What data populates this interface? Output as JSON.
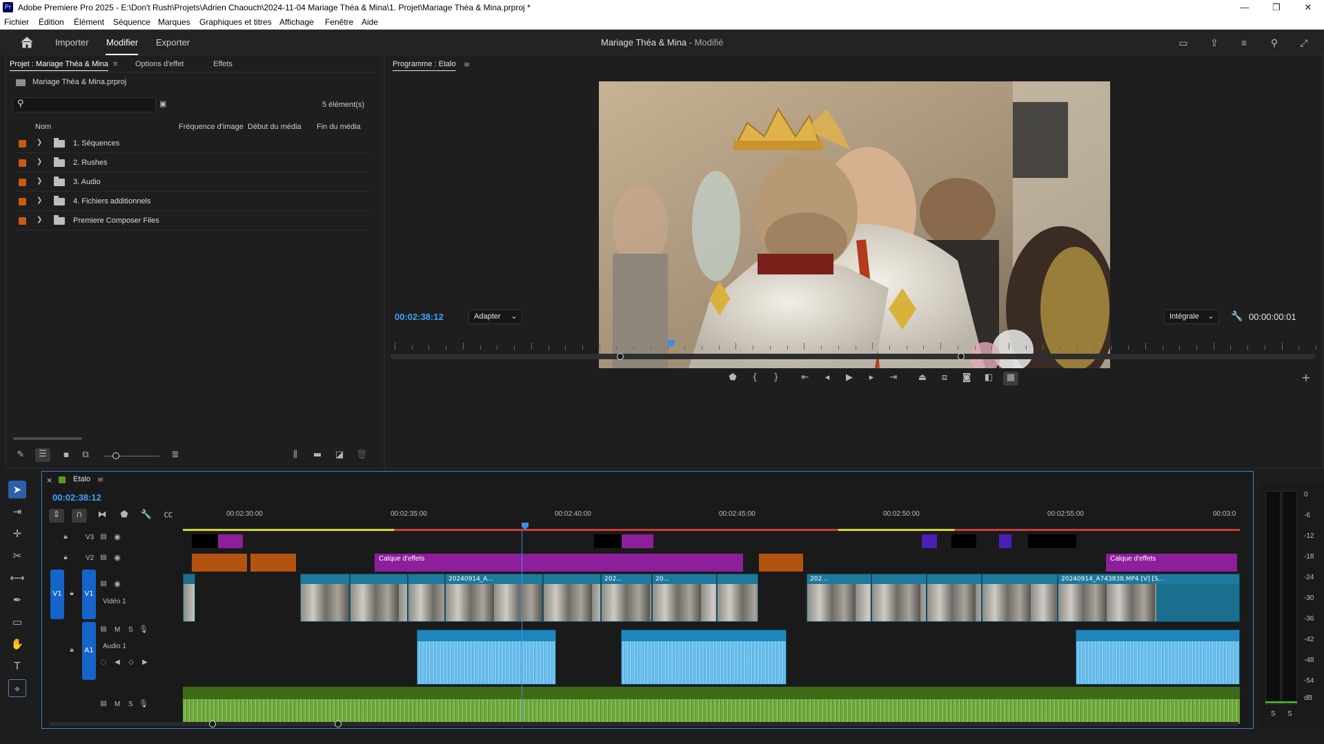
{
  "window": {
    "app_badge": "Pr",
    "title": "Adobe Premiere Pro 2025 - E:\\Don't Rush\\Projets\\Adrien Chaouch\\2024-11-04 Mariage Théa & Mina\\1. Projet\\Mariage Théa & Mina.prproj *",
    "minimize": "—",
    "maximize": "❐",
    "close": "✕"
  },
  "menu": [
    "Fichier",
    "Édition",
    "Élément",
    "Séquence",
    "Marques",
    "Graphiques et titres",
    "Affichage",
    "Fenêtre",
    "Aide"
  ],
  "header": {
    "tabs": [
      "Importer",
      "Modifier",
      "Exporter"
    ],
    "active_tab": "Modifier",
    "project_title": "Mariage Théa & Mina",
    "project_status": " - Modifié"
  },
  "project_panel": {
    "tabs": [
      "Projet : Mariage Théa & Mina",
      "Options d'effet",
      "Effets"
    ],
    "file_name": "Mariage Théa & Mina.prproj",
    "search_placeholder": "",
    "item_count": "5 élément(s)",
    "columns": [
      "Nom",
      "Fréquence d'image",
      "Début du média",
      "Fin du média"
    ],
    "rows": [
      "1. Séquences",
      "2. Rushes",
      "3. Audio",
      "4. Fichiers additionnels",
      "Premiere Composer Files"
    ],
    "label_color": "#c85a12"
  },
  "program_monitor": {
    "title": "Programme : Etalo",
    "timecode": "00:02:38:12",
    "zoom_select": "Adapter",
    "quality_select": "Intégrale",
    "duration": "00:00:00:01",
    "playhead_fraction": 0.3
  },
  "timeline": {
    "sequence_tab": "Etalo",
    "timecode": "00:02:38:12",
    "ruler": [
      "00:02:30:00",
      "00:02:35:00",
      "00:02:40:00",
      "00:02:45:00",
      "00:02:50:00",
      "00:02:55:00",
      "00:03:0"
    ],
    "tracks": {
      "v3": "V3",
      "v2": "V2",
      "v1": "V1",
      "v1_name": "Vidéo 1",
      "a1": "A1",
      "a1_name": "Audio 1",
      "m": "M",
      "s": "S"
    },
    "clips": {
      "calque1": "Calque d'effets",
      "calque2": "Calque d'effets",
      "v1_a": "20240914_A...",
      "v1_b": "202...",
      "v1_c": "20...",
      "v1_d": "202...",
      "v1_e": "20240914_A743838.MP4 [V] [S..."
    },
    "accent": "#2d8ceb"
  },
  "meter": {
    "scale": [
      "0",
      "-6",
      "-12",
      "-18",
      "-24",
      "-30",
      "-36",
      "-42",
      "-48",
      "-54",
      "dB"
    ],
    "solo": [
      "S",
      "S"
    ]
  }
}
